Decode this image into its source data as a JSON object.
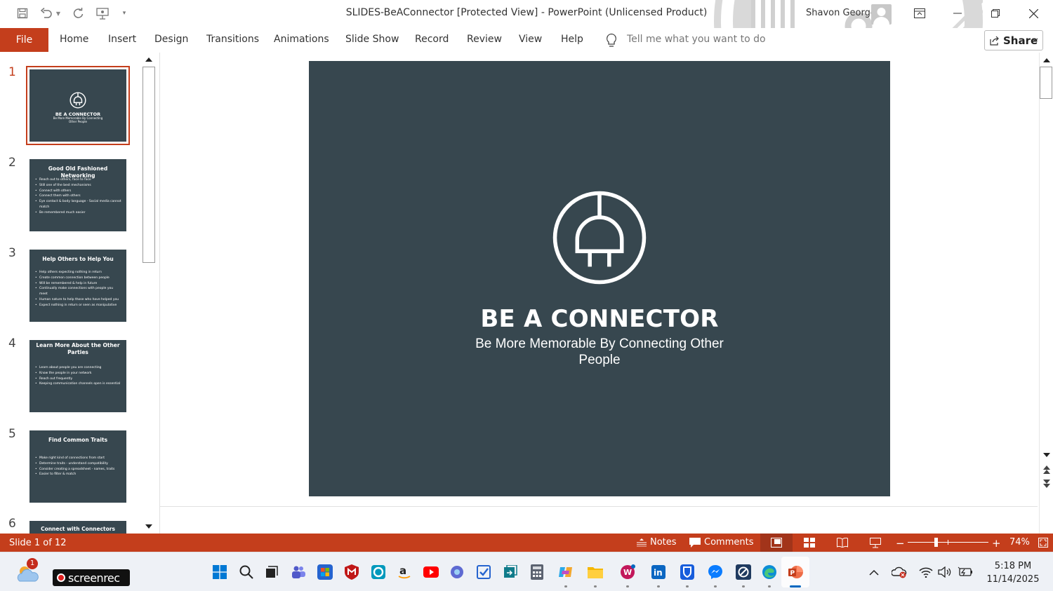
{
  "window": {
    "title": "SLIDES-BeAConnector [Protected View]  -  PowerPoint (Unlicensed Product)",
    "user": "Shavon George"
  },
  "ribbon": {
    "tabs": [
      "File",
      "Home",
      "Insert",
      "Design",
      "Transitions",
      "Animations",
      "Slide Show",
      "Record",
      "Review",
      "View",
      "Help"
    ],
    "search_placeholder": "Tell me what you want to do",
    "share_label": "Share"
  },
  "thumbnails": [
    {
      "num": "1",
      "title": "BE A CONNECTOR",
      "subtitle": "Be More Memorable By Connecting Other People",
      "bullets": []
    },
    {
      "num": "2",
      "title": "Good Old Fashioned Networking",
      "bullets": [
        "Reach out to others, face to face",
        "Still one of the best mechanisms",
        "Connect with others",
        "Connect them with others",
        "Eye contact & body language - Social media cannot match",
        "Be remembered much easier"
      ]
    },
    {
      "num": "3",
      "title": "Help Others to Help You",
      "bullets": [
        "Help others expecting nothing in return",
        "Create common connection between people",
        "Will be remembered & help in future",
        "Continually make connections with people you meet",
        "Human nature to help those who have helped you",
        "Expect nothing in return or seen as manipulative"
      ]
    },
    {
      "num": "4",
      "title": "Learn More About the Other Parties",
      "bullets": [
        "Learn about people you are connecting",
        "Know the people in your network",
        "Reach out frequently",
        "Keeping communication channels open is essential"
      ]
    },
    {
      "num": "5",
      "title": "Find Common Traits",
      "bullets": [
        "Make right kind of connections from start",
        "Determine traits - understand compatibility",
        "Consider creating a spreadsheet - names, traits",
        "Easier to filter & match"
      ]
    },
    {
      "num": "6",
      "title": "Connect with Connectors",
      "bullets": []
    }
  ],
  "slide": {
    "title": "BE A CONNECTOR",
    "subtitle": "Be More Memorable By Connecting Other People"
  },
  "status": {
    "slide_info": "Slide 1 of 12",
    "notes": "Notes",
    "comments": "Comments",
    "zoom": "74%"
  },
  "taskbar": {
    "weather_badge": "1",
    "screenrec_label": "screenrec",
    "time": "5:18 PM",
    "date": "11/14/2025"
  },
  "colors": {
    "accent": "#c43e1c",
    "slide_bg": "#37474f"
  }
}
